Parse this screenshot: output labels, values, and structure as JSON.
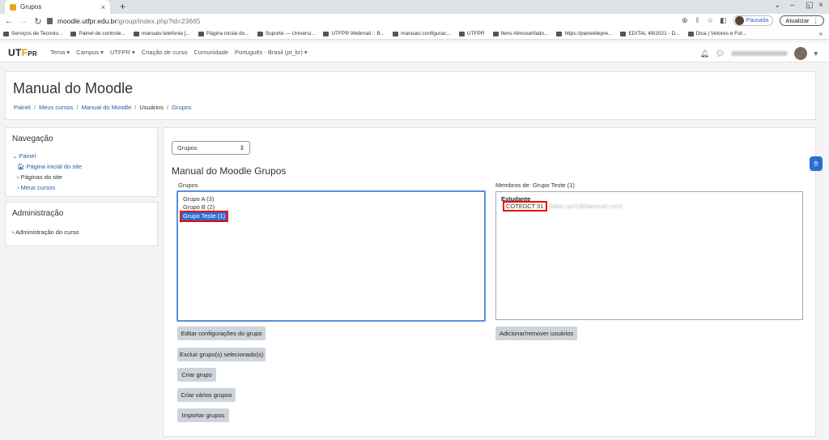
{
  "browser": {
    "tab_title": "Grupos",
    "tab_close": "×",
    "new_tab": "+",
    "url_host": "moodle.utfpr.edu.br",
    "url_path": "/group/index.php?id=23665",
    "profile_status": "Pausada",
    "update_label": "Atualizar",
    "bookmarks": [
      "Serviços de Tecnolo...",
      "Painel de controle...",
      "manuais:telefonia [...",
      "Página inicial do...",
      "Suporte — Universi...",
      "UTFPR Webmail :: B...",
      "manuais:configurac...",
      "UTFPR",
      "Itens Almoxarifado...",
      "https://paineldepre...",
      "EDITAL 49/2021 - D...",
      "Dica | Vetores e Fot..."
    ],
    "bookmarks_more": "»"
  },
  "navbar": {
    "brand_a": "UT",
    "brand_b": "F",
    "brand_c": "PR",
    "menu": [
      "Tema ▾",
      "Campus ▾",
      "UTFPR ▾",
      "Criação de curso",
      "Comunidade",
      "Português - Brasil (pt_br) ▾"
    ]
  },
  "header": {
    "course_title": "Manual do Moodle",
    "breadcrumb": [
      "Painel",
      "Meus cursos",
      "Manual do Moodle",
      "Usuários",
      "Grupos"
    ]
  },
  "navigation_block": {
    "title": "Navegação",
    "root": "Painel",
    "home": "Página inicial do site",
    "pages": "Páginas do site",
    "my_courses": "Meus cursos"
  },
  "admin_block": {
    "title": "Administração",
    "item": "Administração do curso"
  },
  "main": {
    "select_value": "Grupos",
    "section_title": "Manual do Moodle Grupos",
    "groups_label": "Grupos",
    "members_label": "Membros de: Grupo Teste (1)",
    "groups": [
      "Grupo A (3)",
      "Grupo B (2)",
      "Grupo Teste (1)"
    ],
    "members_role": "Estudante",
    "member_name": "COTEDCT 01",
    "member_email": "(fabio.cp01@fakemail.com)",
    "buttons": {
      "edit_group": "Editar configurações do grupo",
      "delete_groups": "Excluir grupo(s) selecionado(s)",
      "create_group": "Criar grupo",
      "create_groups": "Criar vários grupos",
      "import_groups": "Importar grupos",
      "add_remove_users": "Adicionar/remover usuários"
    }
  },
  "colors": {
    "accent": "#1f5fae",
    "highlight": "#e00000",
    "selection": "#2f6fd1"
  }
}
